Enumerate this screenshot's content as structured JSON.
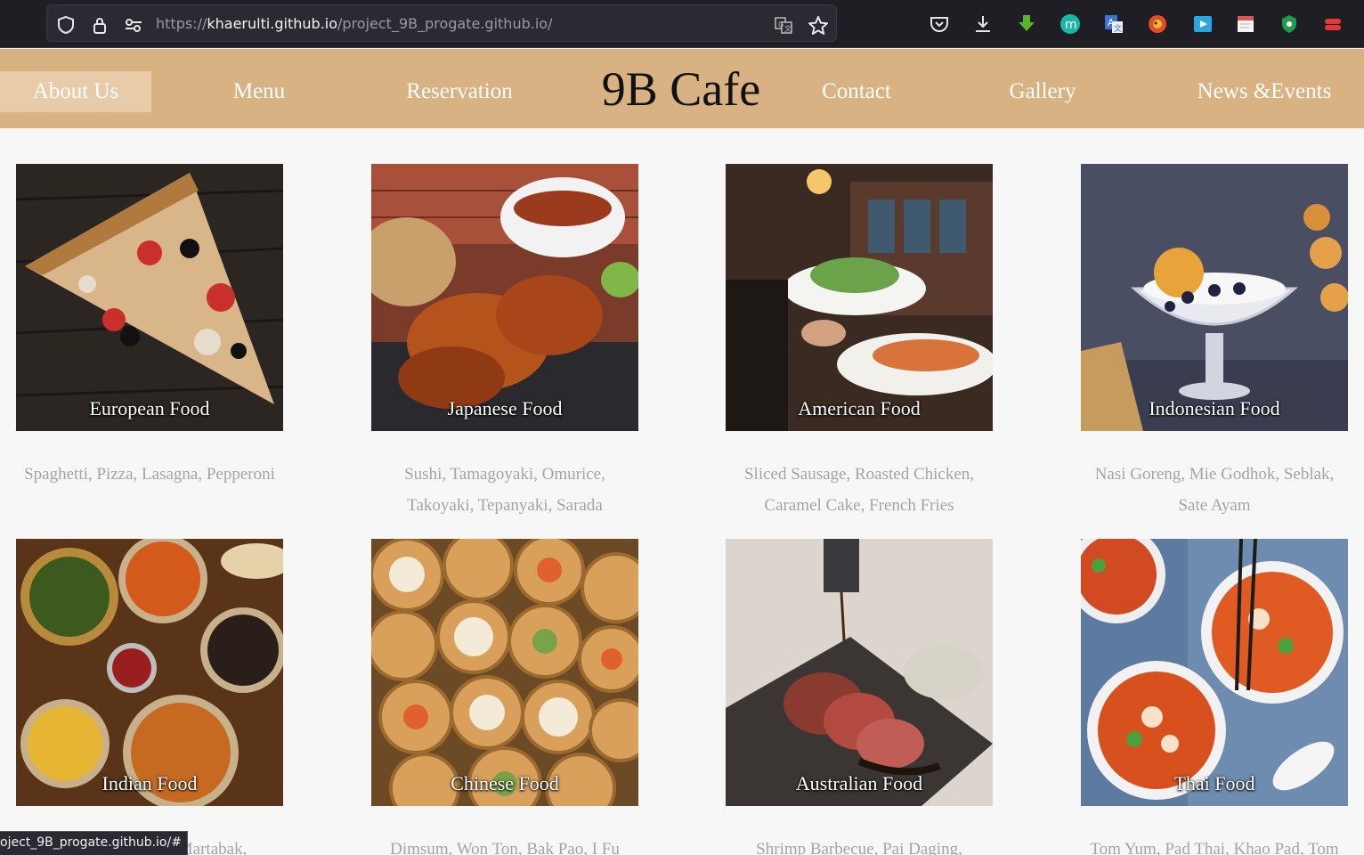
{
  "browser": {
    "url_prefix": "https://",
    "url_host": "khaerulti.github.io",
    "url_path": "/project_9B_progate.github.io/",
    "status_link": "oject_9B_progate.github.io/#"
  },
  "site": {
    "brand": "9B Cafe",
    "nav": [
      {
        "label": "About Us",
        "active": true
      },
      {
        "label": "Menu"
      },
      {
        "label": "Reservation"
      },
      {
        "label": "Contact"
      },
      {
        "label": "Gallery"
      },
      {
        "label": "News &Events"
      }
    ]
  },
  "cards": [
    {
      "title": "European Food",
      "desc": [
        "Spaghetti, Pizza, Lasagna, Pepperoni"
      ]
    },
    {
      "title": "Japanese Food",
      "desc": [
        "Sushi, Tamagoyaki, Omurice,",
        "Takoyaki, Tepanyaki, Sarada"
      ]
    },
    {
      "title": "American Food",
      "desc": [
        "Sliced Sausage, Roasted Chicken,",
        "Caramel Cake, French Fries"
      ]
    },
    {
      "title": "Indonesian Food",
      "desc": [
        "Nasi Goreng, Mie Godhok, Seblak,",
        "Sate Ayam"
      ]
    },
    {
      "title": "Indian Food",
      "desc": [
        "ri, Martabak,"
      ]
    },
    {
      "title": "Chinese Food",
      "desc": [
        "Dimsum, Won Ton, Bak Pao, I Fu"
      ]
    },
    {
      "title": "Australian Food",
      "desc": [
        "Shrimp Barbecue, Pai Daging,"
      ]
    },
    {
      "title": "Thai Food",
      "desc": [
        "Tom Yum, Pad Thai, Khao Pad, Tom"
      ]
    }
  ],
  "colors": {
    "header_bg": "#d8b283",
    "nav_active_bg": "#e8ccaa",
    "page_bg": "#f7f7f7",
    "desc_text": "#a4a4a4"
  },
  "icons": [
    "shield-icon",
    "lock-icon",
    "permissions-icon",
    "translate-icon",
    "bookmark-star-icon",
    "pocket-icon",
    "download-icon",
    "extension-download-icon",
    "extension-m-icon",
    "extension-translate-icon",
    "extension-bird-icon",
    "extension-arrow-icon",
    "extension-note-icon",
    "extension-shield-icon",
    "extension-red-icon"
  ]
}
